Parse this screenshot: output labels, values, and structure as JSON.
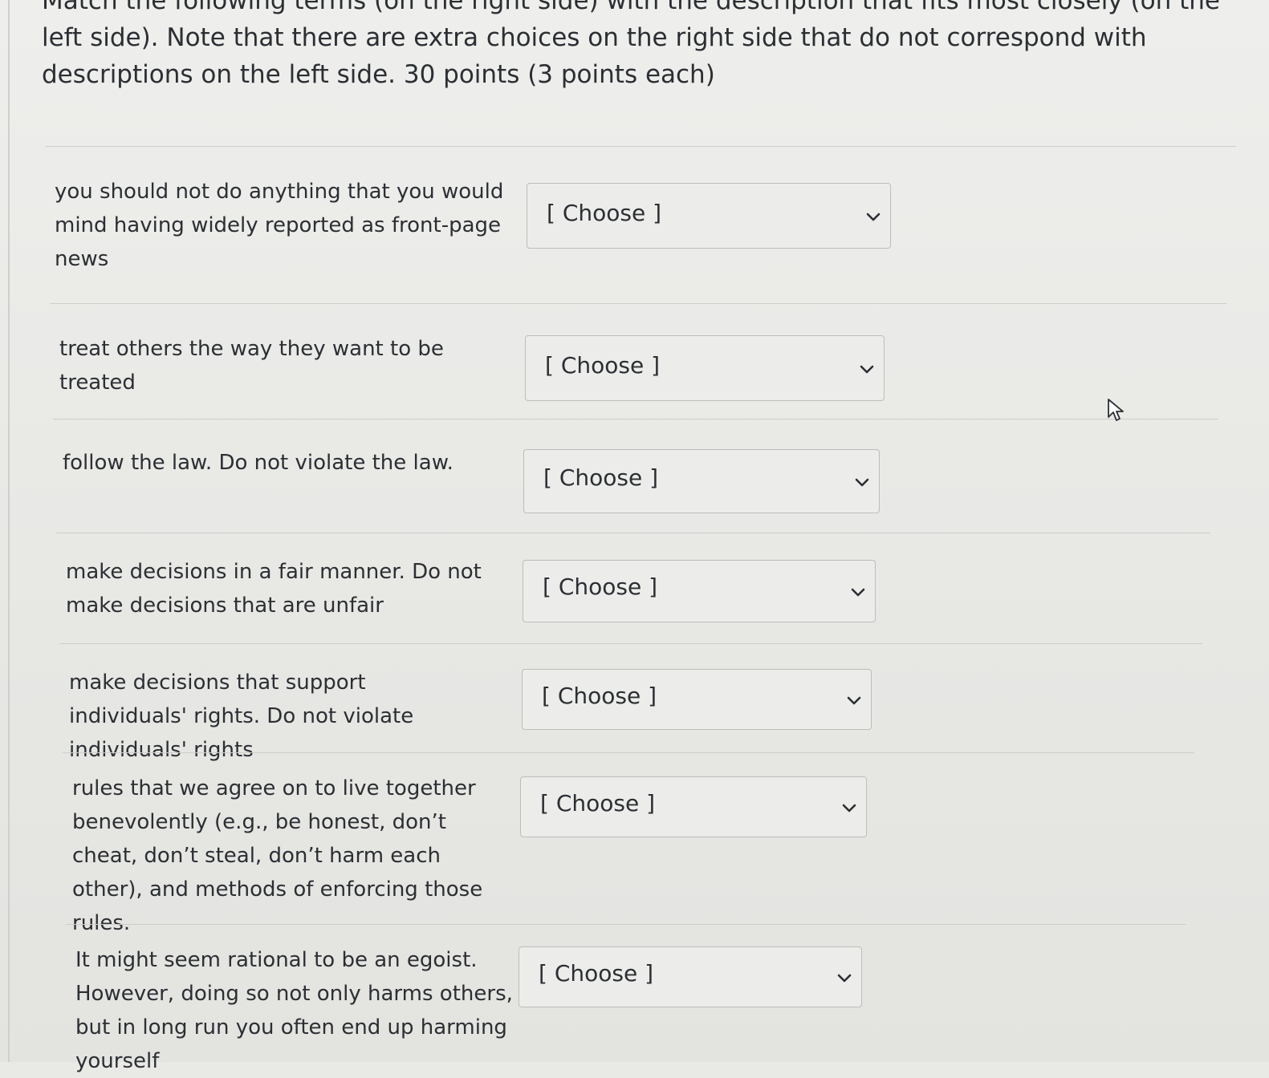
{
  "question": {
    "instructions": "Match the following terms (on the right side) with the description that fits most closely (on the left side).  Note that there are extra choices on the right side that do not correspond with descriptions on the left side.  30 points (3 points each)"
  },
  "rows": [
    {
      "description": "you should not do anything that you would mind having widely reported as front-page news",
      "select": "[ Choose ]"
    },
    {
      "description": "treat others the way they want to be treated",
      "select": "[ Choose ]"
    },
    {
      "description": "follow the law. Do not violate the law.",
      "select": "[ Choose ]"
    },
    {
      "description": "make decisions in a fair manner. Do not make decisions that are unfair",
      "select": "[ Choose ]"
    },
    {
      "description": "make decisions that support individuals' rights. Do not violate individuals' rights",
      "select": "[ Choose ]"
    },
    {
      "description": "rules that we agree on to live together benevolently (e.g., be honest, don’t cheat, don’t steal, don’t harm each other), and methods of enforcing those rules.",
      "select": "[ Choose ]"
    },
    {
      "description": "It might seem rational to be an egoist. However, doing so not only harms others, but in long run you often end up harming yourself",
      "select": "[ Choose ]"
    }
  ],
  "icons": {
    "dropdown": "chevron-down-icon",
    "cursor": "mouse-pointer-icon"
  },
  "colors": {
    "background": "#e9e9e6",
    "text": "#2b2f33",
    "select_border": "#bdbdba",
    "divider": "#cdcdca"
  }
}
